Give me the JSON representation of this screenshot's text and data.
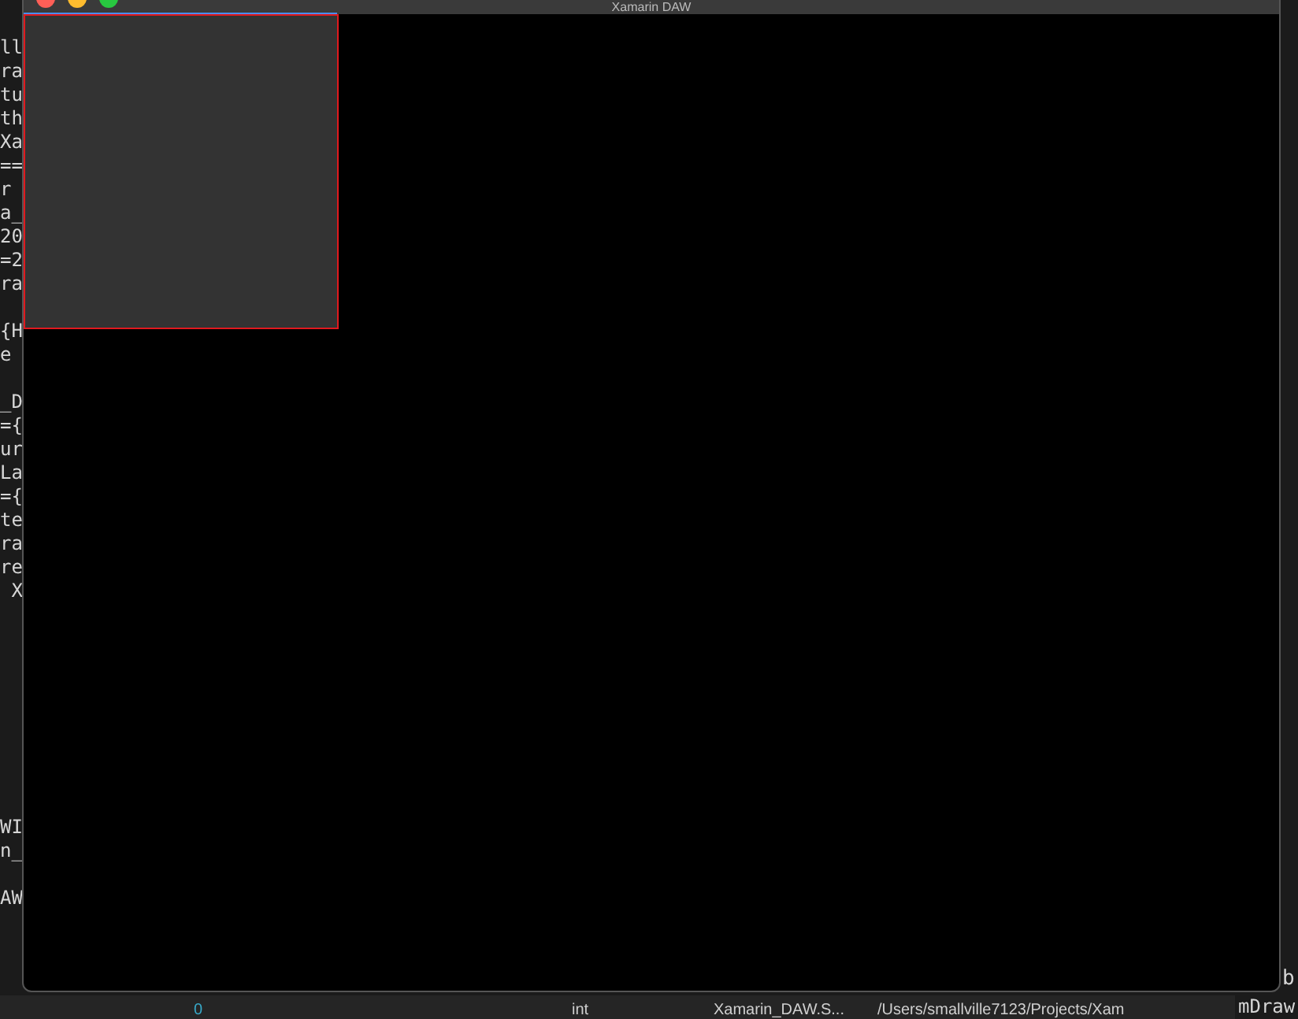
{
  "background_terminal": {
    "blocks": [
      [
        "ll",
        "ra",
        "tu",
        "th",
        "Xa",
        "==",
        "r",
        "a_",
        "20",
        "=2",
        "ra"
      ],
      [
        "{H",
        "e"
      ],
      [
        "_D",
        "={",
        "ur",
        "La",
        "={",
        "te",
        "ra",
        "re",
        " X"
      ],
      [
        "WI",
        "n_"
      ],
      [
        "AW"
      ]
    ]
  },
  "window": {
    "title": "Xamarin DAW"
  },
  "status_bar": {
    "cells": [
      "0",
      "int",
      "Xamarin_DAW.S...",
      "/Users/smallville7123/Projects/Xam"
    ]
  },
  "right_editor": {
    "lines": [
      "b",
      "mDraw"
    ]
  }
}
